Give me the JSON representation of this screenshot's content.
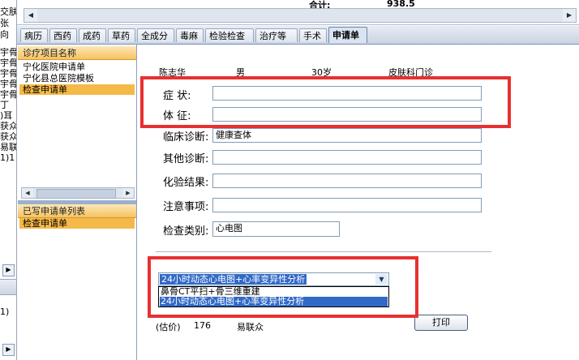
{
  "header": {
    "total_label": "合计:",
    "total_value": "938.5"
  },
  "left_strip": {
    "rows": [
      "交肤",
      "张",
      "向",
      "宇骨",
      "宇骨",
      "宇骨",
      "宇骨",
      "宇骨",
      "丁",
      ")耳",
      "获众",
      "获众",
      "易联",
      "1)1"
    ],
    "lower_rows": [
      "1)"
    ]
  },
  "tabs": [
    {
      "label": "病历"
    },
    {
      "label": "西药"
    },
    {
      "label": "成药"
    },
    {
      "label": "草药"
    },
    {
      "label": "全成分"
    },
    {
      "label": "毒麻"
    },
    {
      "label": "检验检查"
    },
    {
      "label": "治疗等"
    },
    {
      "label": "手术"
    },
    {
      "label": "申请单"
    }
  ],
  "side_panel": {
    "top_header": "诊疗项目名称",
    "top_items": [
      "宁化医院申请单",
      "宁化县总医院模板",
      "检查申请单"
    ],
    "bottom_header": "已写申请单列表",
    "bottom_items": [
      "检查申请单"
    ]
  },
  "patient": {
    "name": "陈志华",
    "sex": "男",
    "age": "30岁",
    "dept": "皮肤科门诊"
  },
  "form": {
    "symptom_label": "症    状:",
    "symptom_value": "",
    "sign_label": "体    征:",
    "sign_value": "",
    "clinical_label": "临床诊断:",
    "clinical_value": "健康查体",
    "other_label": "其他诊断:",
    "other_value": "",
    "lab_label": "化验结果:",
    "lab_value": "",
    "notice_label": "注意事项:",
    "notice_value": "",
    "category_label": "检查类别:",
    "category_value": "心电图"
  },
  "exam_select": {
    "selected": "24小时动态心电图+心率变异性分析",
    "options": [
      "鼻骨CT平扫+骨三维重建",
      "24小时动态心电图+心率变异性分析"
    ]
  },
  "footer": {
    "price_label": "(估价)",
    "price_value": "176",
    "doctor": "易联众",
    "print_label": "打印"
  },
  "colors": {
    "highlight": "#e83030",
    "selection": "#3169c6",
    "panel_header": "#f6c261",
    "selected_item": "#f5b949"
  }
}
